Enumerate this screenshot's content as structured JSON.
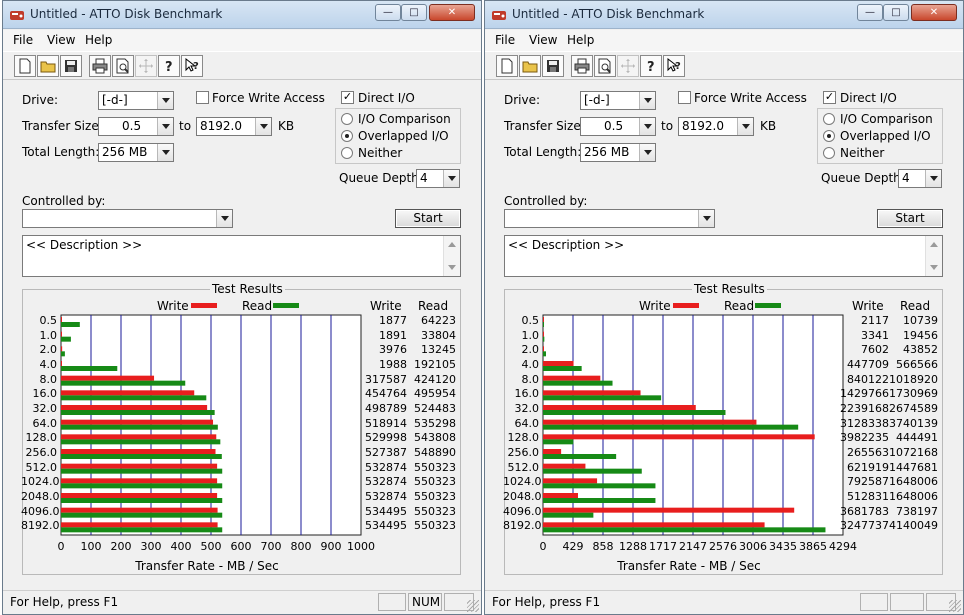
{
  "windows": [
    {
      "title": "Untitled - ATTO Disk Benchmark",
      "menu": {
        "file": "File",
        "view": "View",
        "help": "Help"
      },
      "form": {
        "drive_label": "Drive:",
        "drive_value": "[-d-]",
        "force_write_label": "Force Write Access",
        "force_write_checked": false,
        "direct_io_label": "Direct I/O",
        "direct_io_checked": true,
        "transfer_label": "Transfer Size:",
        "transfer_from": "0.5",
        "to_label": "to",
        "transfer_to": "8192.0",
        "kb_label": "KB",
        "total_label": "Total Length:",
        "total_value": "256 MB",
        "io_comparison": "I/O Comparison",
        "overlapped_io": "Overlapped I/O",
        "neither": "Neither",
        "io_mode": "overlapped",
        "queue_label": "Queue Depth:",
        "queue_value": "4",
        "controlled_label": "Controlled by:",
        "controlled_value": "",
        "start_label": "Start",
        "description": "<< Description >>"
      },
      "results": {
        "title": "Test Results",
        "legend_write": "Write",
        "legend_read": "Read",
        "col_write": "Write",
        "col_read": "Read",
        "xaxis_title": "Transfer Rate - MB / Sec"
      },
      "chart_data": {
        "type": "bar",
        "orientation": "horizontal",
        "categories": [
          "0.5",
          "1.0",
          "2.0",
          "4.0",
          "8.0",
          "16.0",
          "32.0",
          "64.0",
          "128.0",
          "256.0",
          "512.0",
          "1024.0",
          "2048.0",
          "4096.0",
          "8192.0"
        ],
        "series": [
          {
            "name": "Write",
            "color": "#e81e1e",
            "values": [
              1877,
              1891,
              3976,
              1988,
              317587,
              454764,
              498789,
              518914,
              529998,
              527387,
              532874,
              532874,
              532874,
              534495,
              534495
            ]
          },
          {
            "name": "Read",
            "color": "#168a16",
            "values": [
              64223,
              33804,
              13245,
              192105,
              424120,
              495954,
              524483,
              535298,
              543808,
              548890,
              550323,
              550323,
              550323,
              550323,
              550323
            ]
          }
        ],
        "xticks": [
          "0",
          "100",
          "200",
          "300",
          "400",
          "500",
          "600",
          "700",
          "800",
          "900",
          "1000"
        ],
        "xlim": [
          0,
          1000
        ],
        "value_unit_divisor": 1024,
        "xlabel": "Transfer Rate - MB / Sec"
      },
      "status": {
        "help": "For Help, press F1",
        "cell1": "",
        "cell2": "NUM",
        "cell3": ""
      }
    },
    {
      "title": "Untitled - ATTO Disk Benchmark",
      "menu": {
        "file": "File",
        "view": "View",
        "help": "Help"
      },
      "form": {
        "drive_label": "Drive:",
        "drive_value": "[-d-]",
        "force_write_label": "Force Write Access",
        "force_write_checked": false,
        "direct_io_label": "Direct I/O",
        "direct_io_checked": true,
        "transfer_label": "Transfer Size:",
        "transfer_from": "0.5",
        "to_label": "to",
        "transfer_to": "8192.0",
        "kb_label": "KB",
        "total_label": "Total Length:",
        "total_value": "256 MB",
        "io_comparison": "I/O Comparison",
        "overlapped_io": "Overlapped I/O",
        "neither": "Neither",
        "io_mode": "overlapped",
        "queue_label": "Queue Depth:",
        "queue_value": "4",
        "controlled_label": "Controlled by:",
        "controlled_value": "",
        "start_label": "Start",
        "description": "<< Description >>"
      },
      "results": {
        "title": "Test Results",
        "legend_write": "Write",
        "legend_read": "Read",
        "col_write": "Write",
        "col_read": "Read",
        "xaxis_title": "Transfer Rate - MB / Sec"
      },
      "chart_data": {
        "type": "bar",
        "orientation": "horizontal",
        "categories": [
          "0.5",
          "1.0",
          "2.0",
          "4.0",
          "8.0",
          "16.0",
          "32.0",
          "64.0",
          "128.0",
          "256.0",
          "512.0",
          "1024.0",
          "2048.0",
          "4096.0",
          "8192.0"
        ],
        "series": [
          {
            "name": "Write",
            "color": "#e81e1e",
            "values": [
              2117,
              3341,
              7602,
              447709,
              840122,
              1429766,
              2239168,
              3128338,
              3982235,
              265563,
              621919,
              792587,
              512831,
              3681783,
              3247737
            ]
          },
          {
            "name": "Read",
            "color": "#168a16",
            "values": [
              10739,
              19456,
              43852,
              566566,
              1018920,
              1730969,
              2674589,
              3740139,
              444491,
              1072168,
              1447681,
              1648006,
              1648006,
              738197,
              4140049
            ]
          }
        ],
        "xticks": [
          "0",
          "429",
          "858",
          "1288",
          "1717",
          "2147",
          "2576",
          "3006",
          "3435",
          "3865",
          "4294"
        ],
        "xlim": [
          0,
          4294
        ],
        "value_unit_divisor": 1024,
        "xlabel": "Transfer Rate - MB / Sec"
      },
      "status": {
        "help": "For Help, press F1",
        "cell1": "",
        "cell2": "",
        "cell3": ""
      }
    }
  ],
  "colors": {
    "write": "#e81e1e",
    "read": "#168a16",
    "gridline": "#1a1a9a"
  },
  "toolbar_icons": [
    "new-file-icon",
    "open-folder-icon",
    "save-icon",
    "print-icon",
    "print-preview-icon",
    "move-icon",
    "help-icon",
    "context-help-icon"
  ]
}
